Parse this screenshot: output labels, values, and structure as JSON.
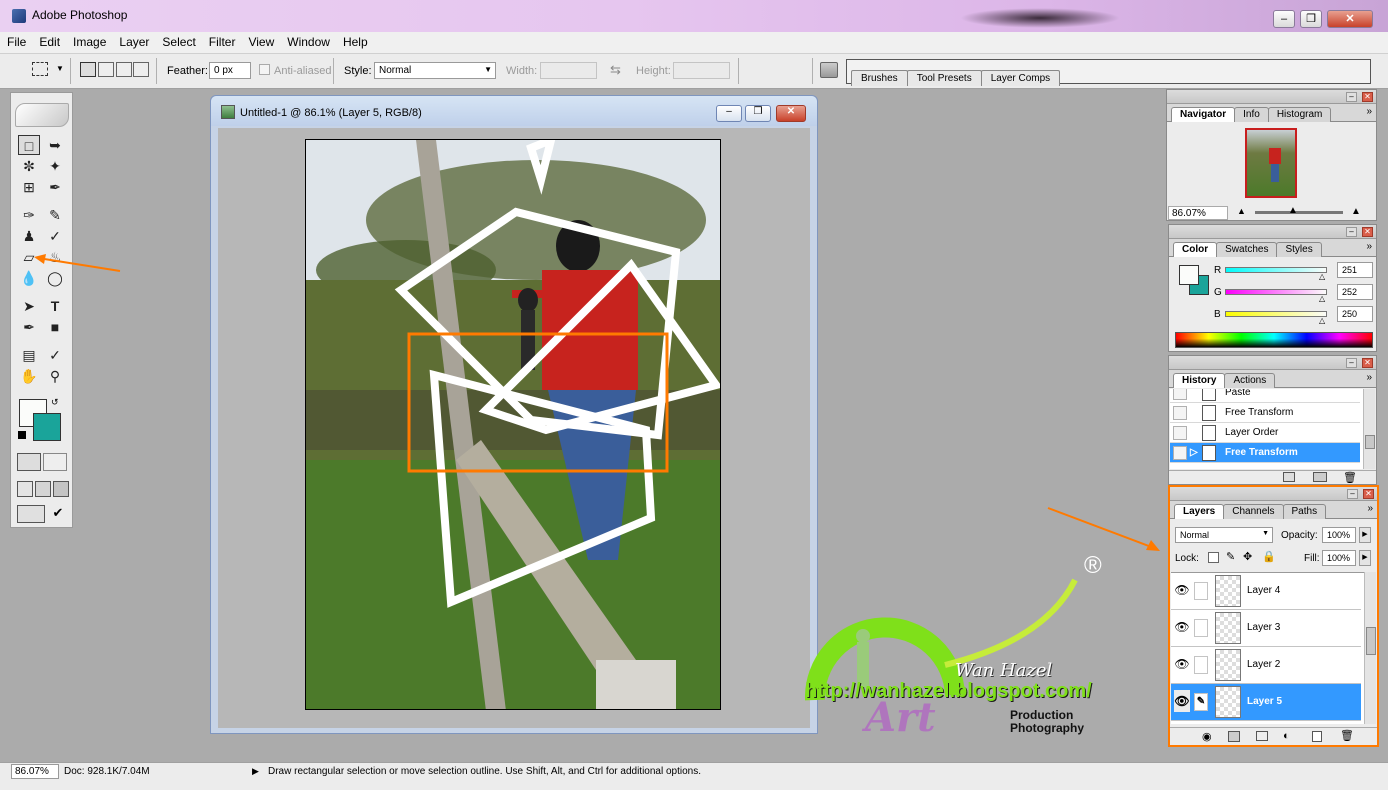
{
  "app": {
    "title": "Adobe Photoshop"
  },
  "menu": [
    "File",
    "Edit",
    "Image",
    "Layer",
    "Select",
    "Filter",
    "View",
    "Window",
    "Help"
  ],
  "options": {
    "feather_label": "Feather:",
    "feather_value": "0 px",
    "antialiased_label": "Anti-aliased",
    "style_label": "Style:",
    "style_value": "Normal",
    "width_label": "Width:",
    "height_label": "Height:"
  },
  "palette_well": {
    "tabs": [
      "Brushes",
      "Tool Presets",
      "Layer Comps"
    ]
  },
  "document": {
    "title": "Untitled-1 @ 86.1% (Layer 5, RGB/8)"
  },
  "navigator": {
    "tabs": [
      "Navigator",
      "Info",
      "Histogram"
    ],
    "zoom": "86.07%"
  },
  "color": {
    "tabs": [
      "Color",
      "Swatches",
      "Styles"
    ],
    "channels": [
      {
        "label": "R",
        "value": "251"
      },
      {
        "label": "G",
        "value": "252"
      },
      {
        "label": "B",
        "value": "250"
      }
    ],
    "foreground": "#fbfcfa",
    "background": "#1aa49a"
  },
  "history": {
    "tabs": [
      "History",
      "Actions"
    ],
    "items": [
      "Paste",
      "Free Transform",
      "Layer Order",
      "Free Transform"
    ]
  },
  "layers": {
    "tabs": [
      "Layers",
      "Channels",
      "Paths"
    ],
    "blend": "Normal",
    "opacity_label": "Opacity:",
    "opacity": "100%",
    "lock_label": "Lock:",
    "fill_label": "Fill:",
    "fill": "100%",
    "items": [
      "Layer 4",
      "Layer 3",
      "Layer 2",
      "Layer 5"
    ]
  },
  "status": {
    "zoom": "86.07%",
    "doc": "Doc: 928.1K/7.04M",
    "hint": "Draw rectangular selection or move selection outline.  Use Shift, Alt, and Ctrl for additional options."
  },
  "watermark": {
    "registered": "®",
    "name": "Wan Hazel",
    "url": "http://wanhazel.blogspot.com/",
    "brand": "Art",
    "tag1": "Production",
    "tag2": "Photography"
  },
  "colors": {
    "accent": "#3399ff",
    "highlight_box": "#ff7a00"
  }
}
